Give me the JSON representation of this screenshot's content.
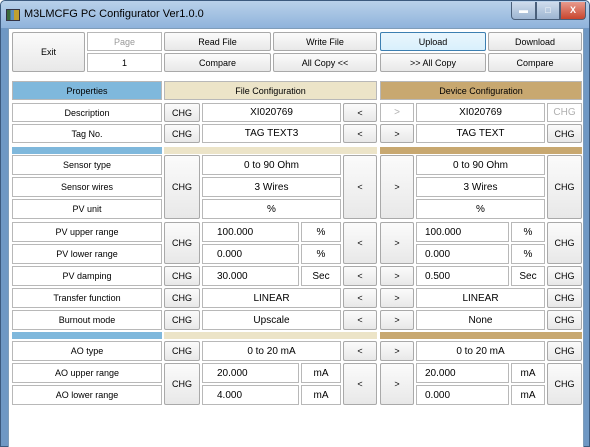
{
  "window": {
    "title": "M3LMCFG PC Configurator Ver1.0.0",
    "minimize": "▬",
    "maximize": "□",
    "close": "X"
  },
  "toolbar": {
    "exit": "Exit",
    "page_label": "Page",
    "page_value": "1",
    "read_file": "Read File",
    "write_file": "Write File",
    "compare_file": "Compare",
    "all_copy_left": "All Copy <<",
    "upload": "Upload",
    "download": "Download",
    "all_copy_right": ">> All Copy",
    "compare_device": "Compare"
  },
  "headers": {
    "properties": "Properties",
    "file": "File Configuration",
    "device": "Device Configuration"
  },
  "buttons": {
    "chg": "CHG",
    "left": "<",
    "right": ">"
  },
  "rows": {
    "description": {
      "label": "Description",
      "file": "XI020769",
      "device": "XI020769"
    },
    "tag": {
      "label": "Tag No.",
      "file": "TAG TEXT3",
      "device": "TAG TEXT"
    },
    "sensor_type": {
      "label": "Sensor type",
      "file": "0 to 90 Ohm",
      "device": "0 to 90 Ohm"
    },
    "sensor_wires": {
      "label": "Sensor wires",
      "file": "3 Wires",
      "device": "3 Wires"
    },
    "pv_unit": {
      "label": "PV unit",
      "file": "%",
      "device": "%"
    },
    "pv_upper": {
      "label": "PV upper range",
      "file": "100.000",
      "file_unit": "%",
      "device": "100.000",
      "device_unit": "%"
    },
    "pv_lower": {
      "label": "PV lower range",
      "file": "0.000",
      "file_unit": "%",
      "device": "0.000",
      "device_unit": "%"
    },
    "pv_damping": {
      "label": "PV damping",
      "file": "30.000",
      "file_unit": "Sec",
      "device": "0.500",
      "device_unit": "Sec"
    },
    "transfer": {
      "label": "Transfer function",
      "file": "LINEAR",
      "device": "LINEAR"
    },
    "burnout": {
      "label": "Burnout mode",
      "file": "Upscale",
      "device": "None"
    },
    "ao_type": {
      "label": "AO type",
      "file": "0 to 20 mA",
      "device": "0 to 20 mA"
    },
    "ao_upper": {
      "label": "AO upper range",
      "file": "20.000",
      "file_unit": "mA",
      "device": "20.000",
      "device_unit": "mA"
    },
    "ao_lower": {
      "label": "AO lower range",
      "file": "4.000",
      "file_unit": "mA",
      "device": "0.000",
      "device_unit": "mA"
    }
  },
  "colors": {
    "properties_hdr": "#7fb8dc",
    "file_hdr": "#ece4c8",
    "device_hdr": "#c8a870",
    "band_blue": "#7fb8dc",
    "band_file": "#ece4c8",
    "band_device": "#c8a870"
  }
}
